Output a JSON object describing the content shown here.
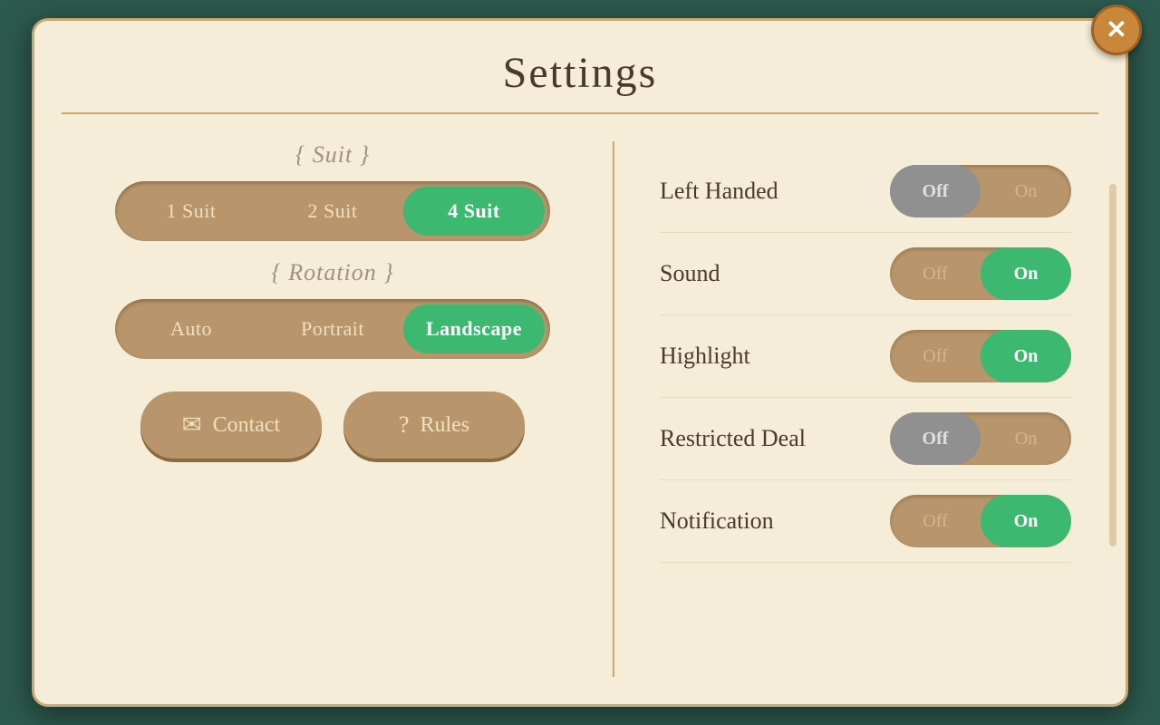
{
  "modal": {
    "title": "Settings",
    "close_label": "✕"
  },
  "suit_section": {
    "label": "{ Suit }",
    "options": [
      "1 Suit",
      "2 Suit",
      "4 Suit"
    ],
    "active_index": 2
  },
  "rotation_section": {
    "label": "{ Rotation }",
    "options": [
      "Auto",
      "Portrait",
      "Landscape"
    ],
    "active_index": 2
  },
  "action_buttons": [
    {
      "label": "Contact",
      "icon": "✉"
    },
    {
      "label": "Rules",
      "icon": "?"
    }
  ],
  "settings": [
    {
      "label": "Left Handed",
      "value": "on",
      "off_label": "Off",
      "on_label": "On"
    },
    {
      "label": "Sound",
      "value": "on",
      "off_label": "Off",
      "on_label": "On"
    },
    {
      "label": "Highlight",
      "value": "on",
      "off_label": "Off",
      "on_label": "On"
    },
    {
      "label": "Restricted Deal",
      "value": "off",
      "off_label": "Off",
      "on_label": "On"
    },
    {
      "label": "Notification",
      "value": "on",
      "off_label": "Off",
      "on_label": "On"
    }
  ]
}
